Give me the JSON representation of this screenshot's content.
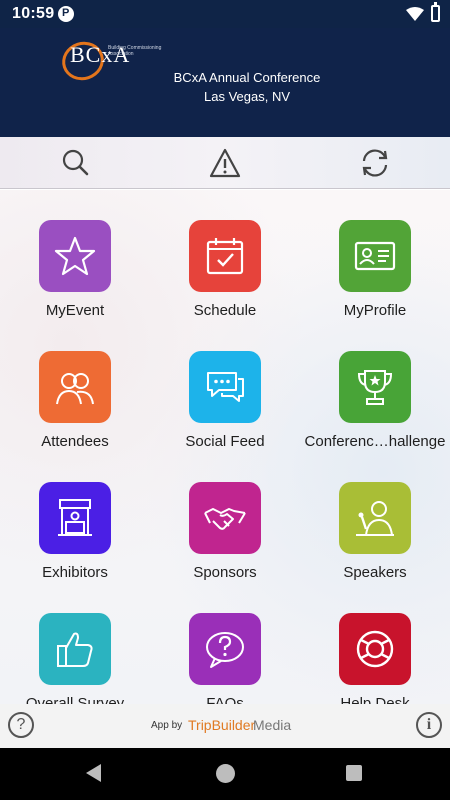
{
  "status_bar": {
    "time": "10:59"
  },
  "header": {
    "logo_text": "BCxA",
    "logo_subtitle": "Building Commissioning Association",
    "conference_line1": "BCxA Annual Conference",
    "conference_line2": "Las Vegas, NV"
  },
  "toolbar": {
    "icons": [
      "search-icon",
      "alert-icon",
      "refresh-icon"
    ]
  },
  "tiles": [
    {
      "label": "MyEvent",
      "color": "#9a4fc1",
      "icon": "star-icon"
    },
    {
      "label": "Schedule",
      "color": "#e6433b",
      "icon": "calendar-check-icon"
    },
    {
      "label": "MyProfile",
      "color": "#52a437",
      "icon": "id-card-icon"
    },
    {
      "label": "Attendees",
      "color": "#ee6b34",
      "icon": "people-icon"
    },
    {
      "label": "Social Feed",
      "color": "#1db3ea",
      "icon": "chat-bubbles-icon"
    },
    {
      "label": "Conferenc…hallenge",
      "color": "#48a437",
      "icon": "trophy-icon"
    },
    {
      "label": "Exhibitors",
      "color": "#4b1fe5",
      "icon": "booth-icon"
    },
    {
      "label": "Sponsors",
      "color": "#c0258f",
      "icon": "handshake-icon"
    },
    {
      "label": "Speakers",
      "color": "#a9be36",
      "icon": "speaker-icon"
    },
    {
      "label": "Overall Survey",
      "color": "#2bb3c0",
      "icon": "thumbs-up-icon"
    },
    {
      "label": "FAQs",
      "color": "#9a2fb8",
      "icon": "question-bubble-icon"
    },
    {
      "label": "Help Desk",
      "color": "#c8132c",
      "icon": "lifebuoy-icon"
    }
  ],
  "footer": {
    "app_by": "App by",
    "brand_part1": "TripBuilder",
    "brand_part2": "Media",
    "help_symbol": "?",
    "info_symbol": "i"
  }
}
